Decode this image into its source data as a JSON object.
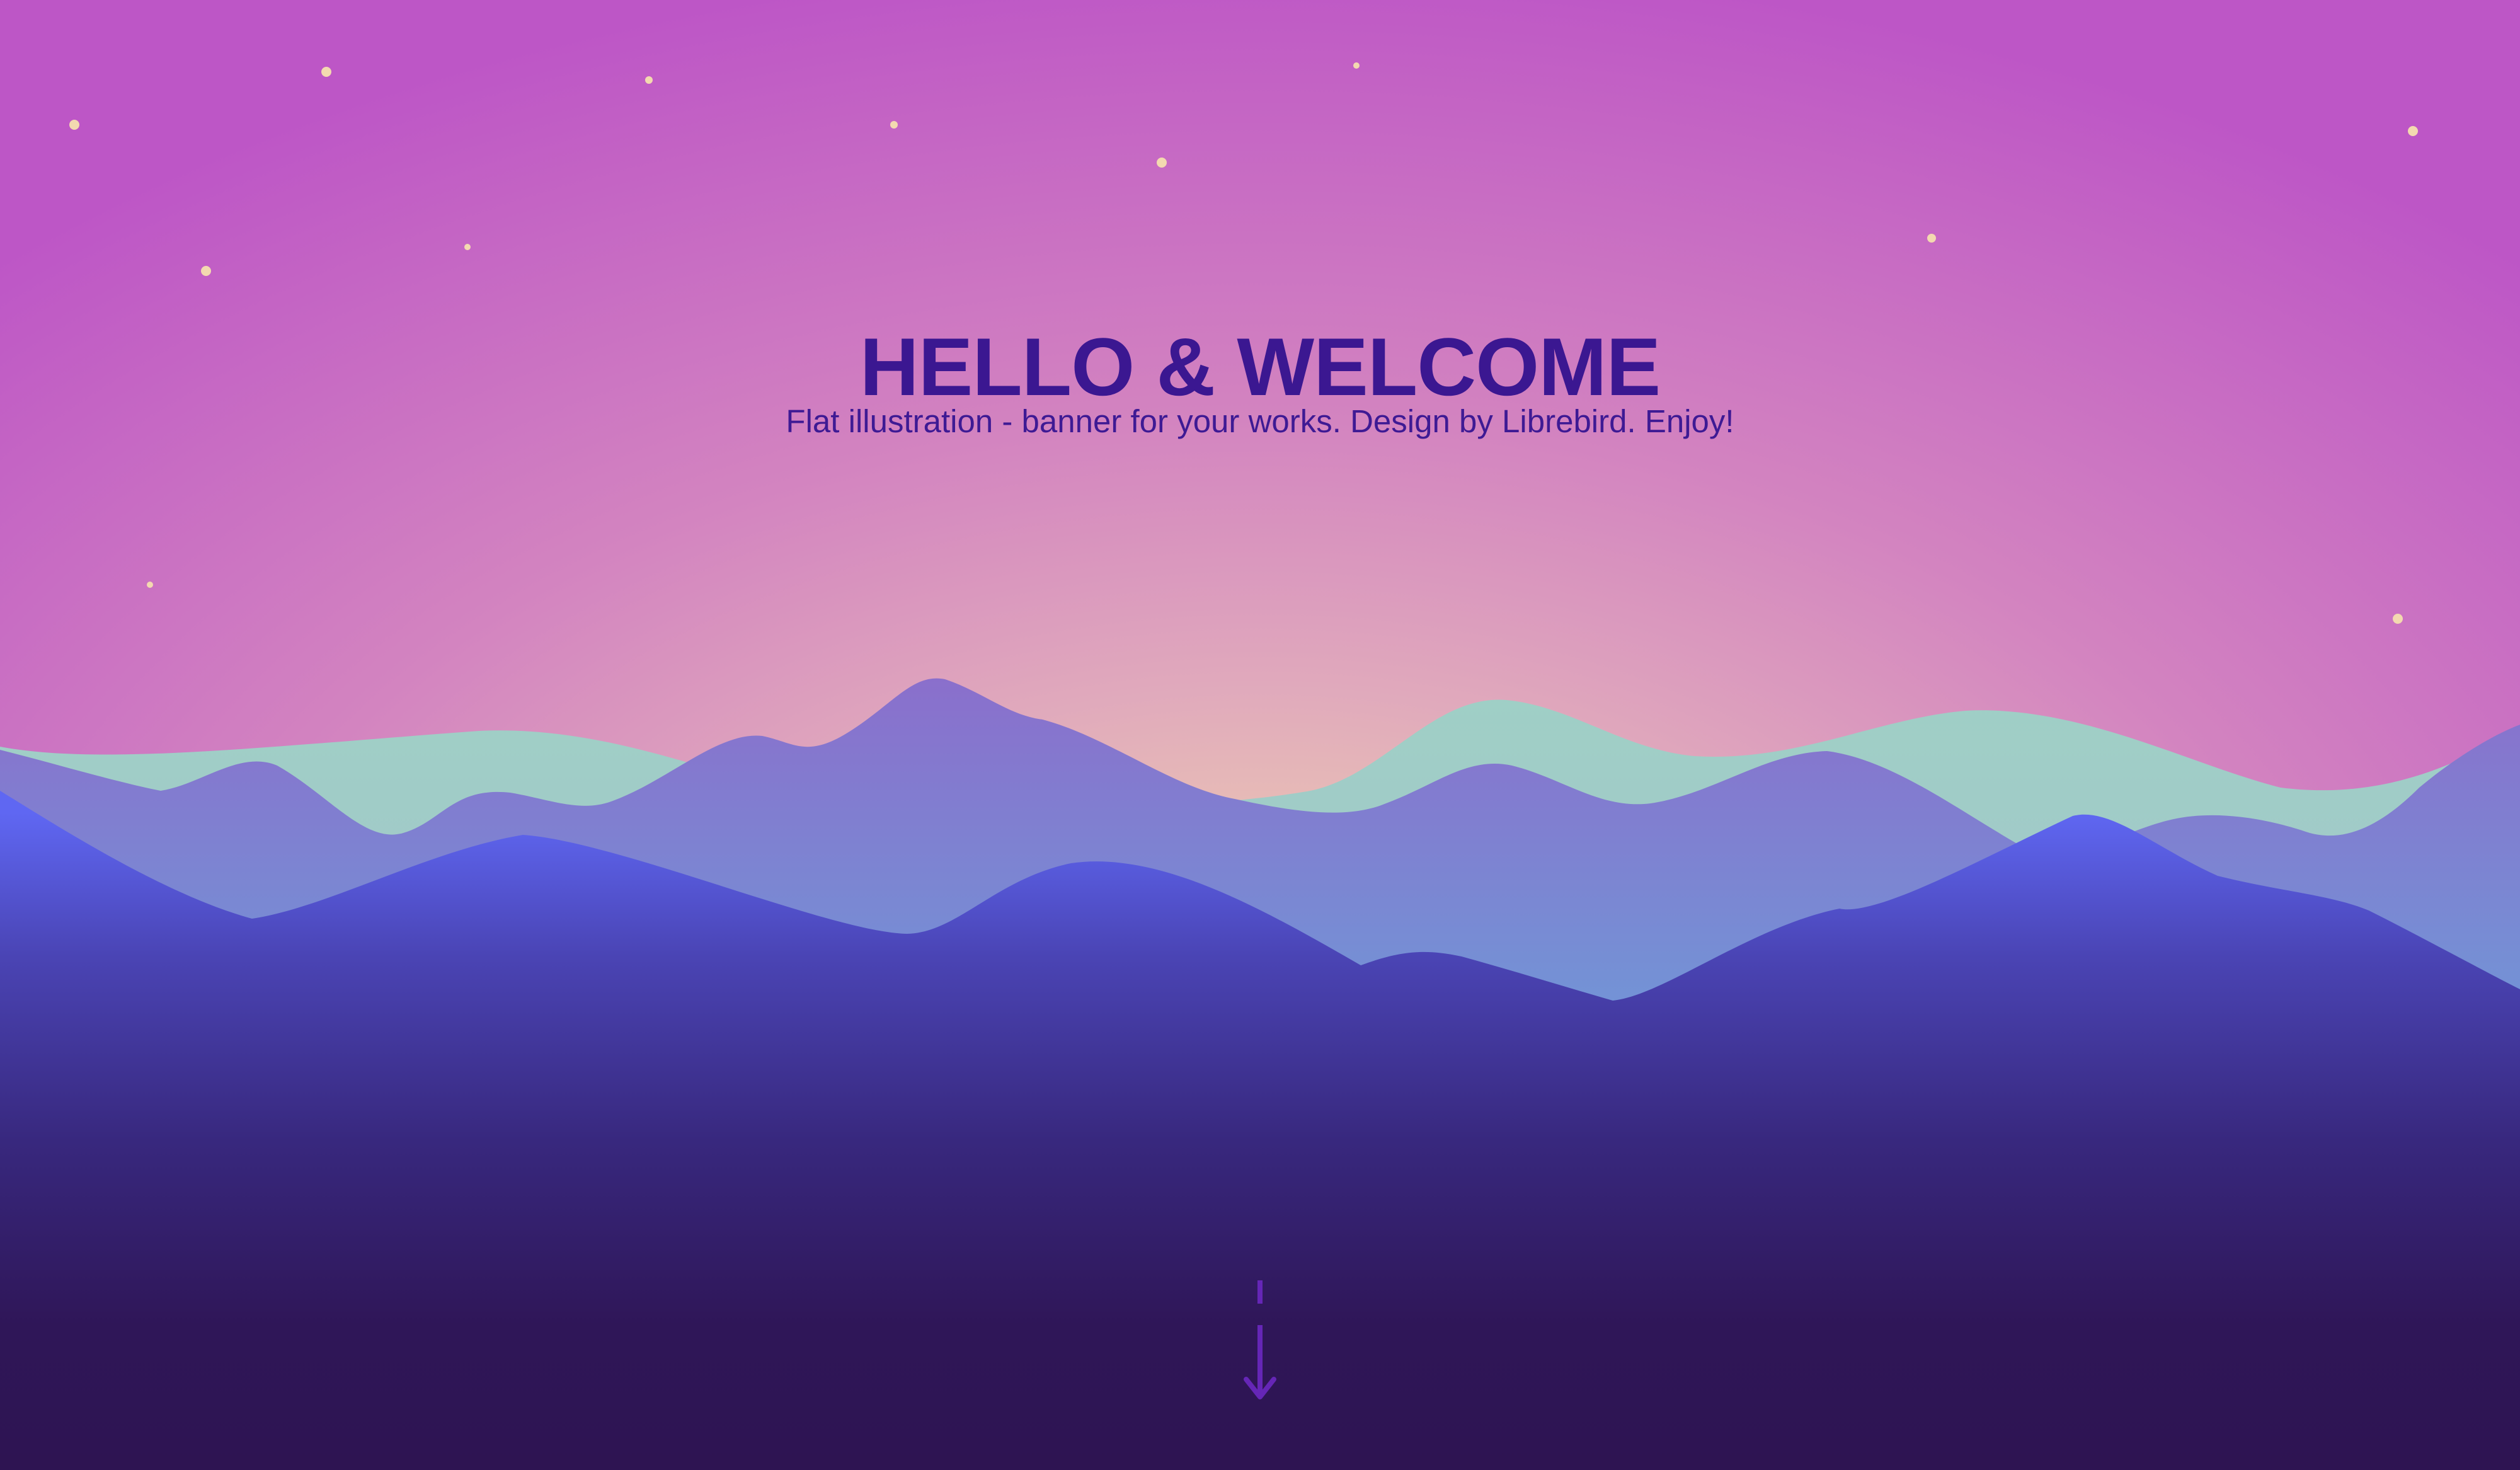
{
  "hero": {
    "title": "HELLO & WELCOME",
    "subtitle": "Flat illustration - banner for your works. Design by Librebird. Enjoy!"
  },
  "scroll_indicator": {
    "icon": "arrow-down-icon"
  },
  "scenery": {
    "celestial": [
      "moon-icon",
      "star-icon"
    ],
    "colors": {
      "title_text": "#3b1791",
      "sky_top": "#bd56c6",
      "sky_glow": "#f4e4b6",
      "ground": "#2e1452",
      "mountains_far": "#a9b8cf",
      "mountains_mid": "#5fb6de",
      "mountains_front": "#5a62ea",
      "stars": "#f3d9b0",
      "arrow": "#6526b6"
    }
  }
}
